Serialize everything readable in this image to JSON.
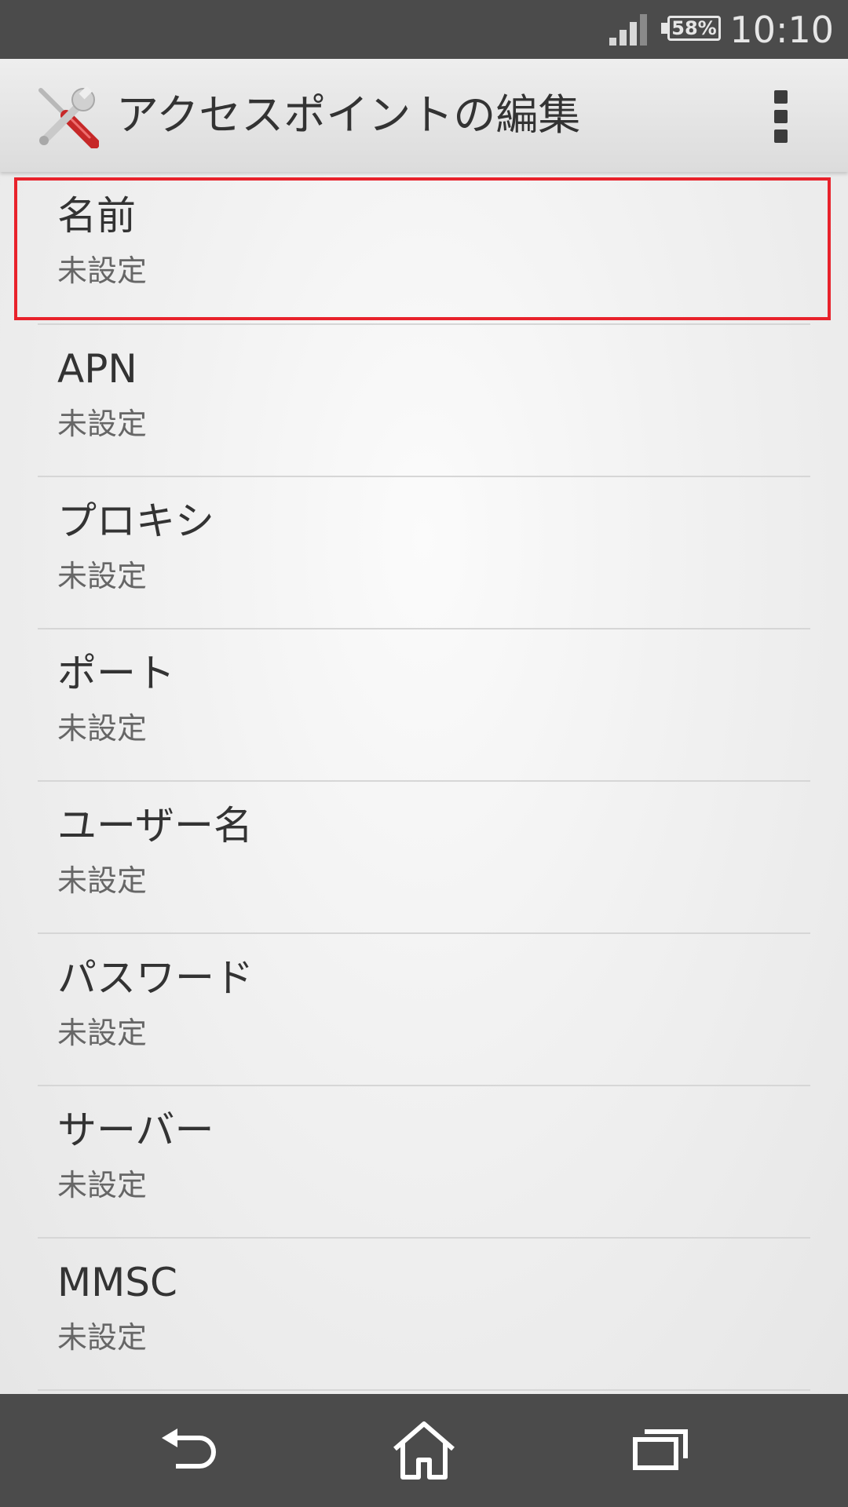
{
  "status_bar": {
    "battery": "58%",
    "clock": "10:10"
  },
  "action_bar": {
    "title": "アクセスポイントの編集",
    "icon": "tools-icon",
    "menu_icon": "overflow-menu-icon"
  },
  "list": {
    "items": [
      {
        "title": "名前",
        "summary": "未設定",
        "highlighted": true
      },
      {
        "title": "APN",
        "summary": "未設定"
      },
      {
        "title": "プロキシ",
        "summary": "未設定"
      },
      {
        "title": "ポート",
        "summary": "未設定"
      },
      {
        "title": "ユーザー名",
        "summary": "未設定"
      },
      {
        "title": "パスワード",
        "summary": "未設定"
      },
      {
        "title": "サーバー",
        "summary": "未設定"
      },
      {
        "title": "MMSC",
        "summary": "未設定"
      }
    ]
  },
  "nav_bar": {
    "back": "back-icon",
    "home": "home-icon",
    "recent": "recent-apps-icon"
  },
  "colors": {
    "highlight": "#e8222b",
    "bars": "#4b4b4b"
  }
}
